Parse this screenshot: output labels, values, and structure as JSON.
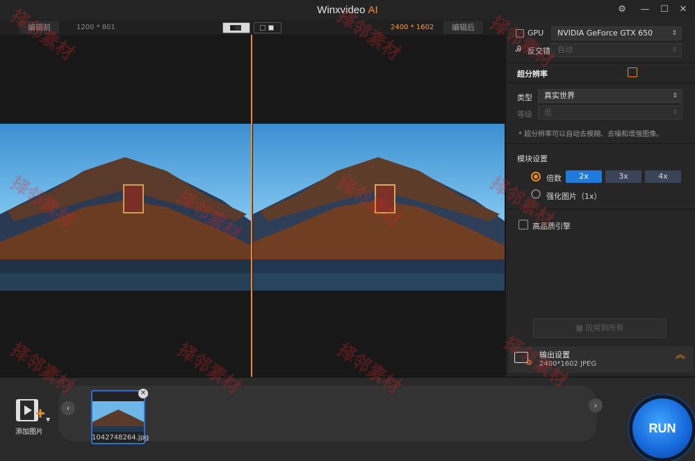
{
  "window": {
    "title": "Winxvideo",
    "title_suffix": "AI",
    "controls": {
      "settings": "⚙",
      "minimize": "—",
      "maximize": "☐",
      "close": "✕"
    }
  },
  "compare": {
    "before_label": "编辑前",
    "before_resolution": "1200 * 801",
    "after_resolution": "2400 * 1602",
    "after_label": "编辑后",
    "accent_color": "#f08a22"
  },
  "panel": {
    "gpu_label": "GPU",
    "gpu_value": "NVIDIA GeForce GTX 650",
    "deinterlace_label": "反交错",
    "deinterlace_value": "自动",
    "super_resolution_title": "超分辨率",
    "type_label": "类型",
    "type_value": "真实世界",
    "level_label": "等级",
    "level_value": "低",
    "hint": "* 超分辨率可以自动去模糊、去噪和增强图像。",
    "model_settings_title": "模块设置",
    "scale_label": "倍数",
    "scale_options": [
      "2x",
      "3x",
      "4x"
    ],
    "scale_selected": "2x",
    "enhance_label": "强化图片（1x）",
    "hq_engine_label": "高品质引擎",
    "apply_all_label": "应用到所有",
    "output_title": "输出设置",
    "output_value": "2400*1602  JPEG"
  },
  "bottom": {
    "add_image_label": "添加图片",
    "thumbnail_name": "1042748264.jpg",
    "run_label": "RUN",
    "prev_arrow": "‹",
    "next_arrow": "›",
    "close_glyph": "✕"
  },
  "watermark": "择邻素材"
}
